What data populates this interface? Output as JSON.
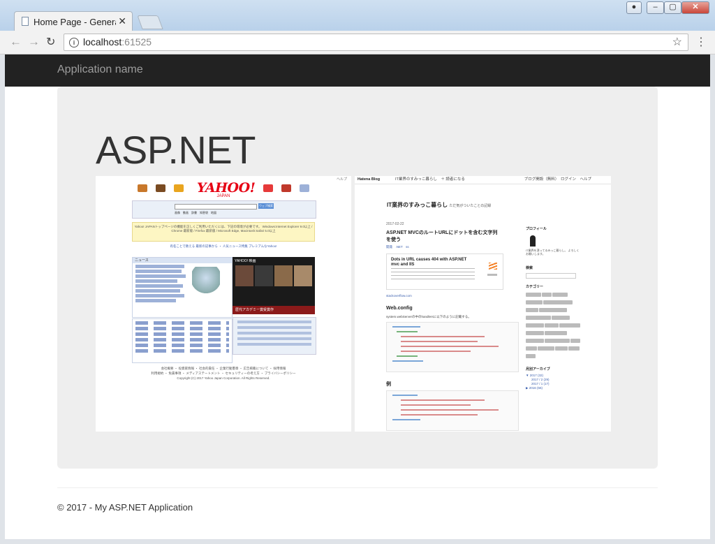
{
  "browser": {
    "tab_title": "Home Page - Generated",
    "tab_close": "✕",
    "url_host": "localhost",
    "url_port": ":61525",
    "window_buttons": {
      "minimize": "–",
      "maximize": "▢",
      "close": "✕"
    }
  },
  "navbar": {
    "brand": "Application name"
  },
  "hero": {
    "title": "ASP.NET"
  },
  "yahoo": {
    "help": "ヘルプ",
    "logo_big": "YAHOO!",
    "logo_small": "JAPAN",
    "search_button": "ウェブ検索",
    "search_tabs": "画像　動画　辞書　知恵袋　地図",
    "notice": "Yahoo! JAPANトップページの機能を正しくご利用いただくには、下記の環境が必要です。 Windows:Internet Explorer 9.0以上 / Chrome 最新版 / Firefox 最新版 / Microsoft Edge, Macintosh:Safari 5.0以上",
    "links": "有名ことで教える 最新の記事から ・ 人気ニュース特集 プレミアムなYahoo!",
    "news_header": "ニュース",
    "ad_header": "YAHOO! 映画",
    "ad_bar": "歴代アカデミー賞受賞作",
    "footer_line1": "会社概要 ・ 投資家情報 ・ 社会的責任 ・ 企業行動憲章 ・ 広告掲載について ・ 採用情報",
    "footer_line2": "利用規約 ・ 免責事項 ・ メディアステートメント ・ セキュリティーの考え方 ・ プライバシーポリシー",
    "footer_line3": "Copyright (C) 2017 Yahoo Japan Corporation. All Rights Reserved."
  },
  "hatena": {
    "logo": "Hatena Blog",
    "bar_middle": "IT業界のすみっこ暮らし　＋ 読者になる",
    "bar_right": "ブログ開設（無料）　ログイン　ヘルプ",
    "blog_title": "IT業界のすみっこ暮らし",
    "blog_subtitle": "ただ気がついたことの記録",
    "post_date": "2017-02-22",
    "post_title": "ASP.NET MVCのルートURLにドットを含む文字列を使う",
    "post_tags": "開発　.NET　ss",
    "card_title": "Dots in URL causes 404 with ASP.NET mvc and IIS",
    "card_link": "stackoverflow.com",
    "section_title": "Web.config",
    "section_text": "system.webServerの中のhandlersに以下のように記載する。",
    "example_title": "例",
    "profile_header": "プロフィール",
    "profile_text": "IT業界を漂ってるみっこ暮らし。 よろしくお願いします。",
    "search_header": "検索",
    "category_header": "カテゴリー",
    "archive_header": "月別アーカイブ",
    "archive_items": [
      "▼ 2017 (32)",
      "2017 / 2 (29)",
      "2017 / 1 (17)",
      "▶ 2016 (56)"
    ]
  },
  "footer": {
    "copyright": "© 2017 - My ASP.NET Application"
  }
}
